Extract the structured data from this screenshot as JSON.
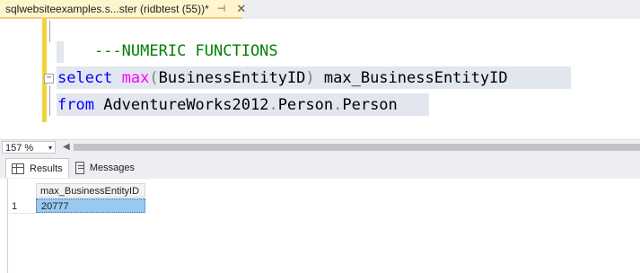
{
  "tab": {
    "title": "sqlwebsiteexamples.s...ster (ridbtest (55))*",
    "pin_glyph": "⊣",
    "close_glyph": "✕"
  },
  "editor": {
    "comment": "---NUMERIC FUNCTIONS",
    "line1": {
      "kw_select": "select",
      "fn_max": "max",
      "paren_open": "(",
      "arg": "BusinessEntityID",
      "paren_close": ")",
      "alias": " max_BusinessEntityID"
    },
    "line2": {
      "kw_from": "from",
      "db": "AdventureWorks2012",
      "dot1": ".",
      "schema": "Person",
      "dot2": ".",
      "table": "Person"
    },
    "collapse_glyph": "−"
  },
  "zoom": {
    "value": "157 %",
    "arrow": "▾",
    "scroll_left_glyph": "◀"
  },
  "result_tabs": {
    "results_label": "Results",
    "messages_label": "Messages"
  },
  "grid": {
    "columns": [
      "max_BusinessEntityID"
    ],
    "rows": [
      {
        "num": "1",
        "cells": [
          "20777"
        ]
      }
    ]
  }
}
